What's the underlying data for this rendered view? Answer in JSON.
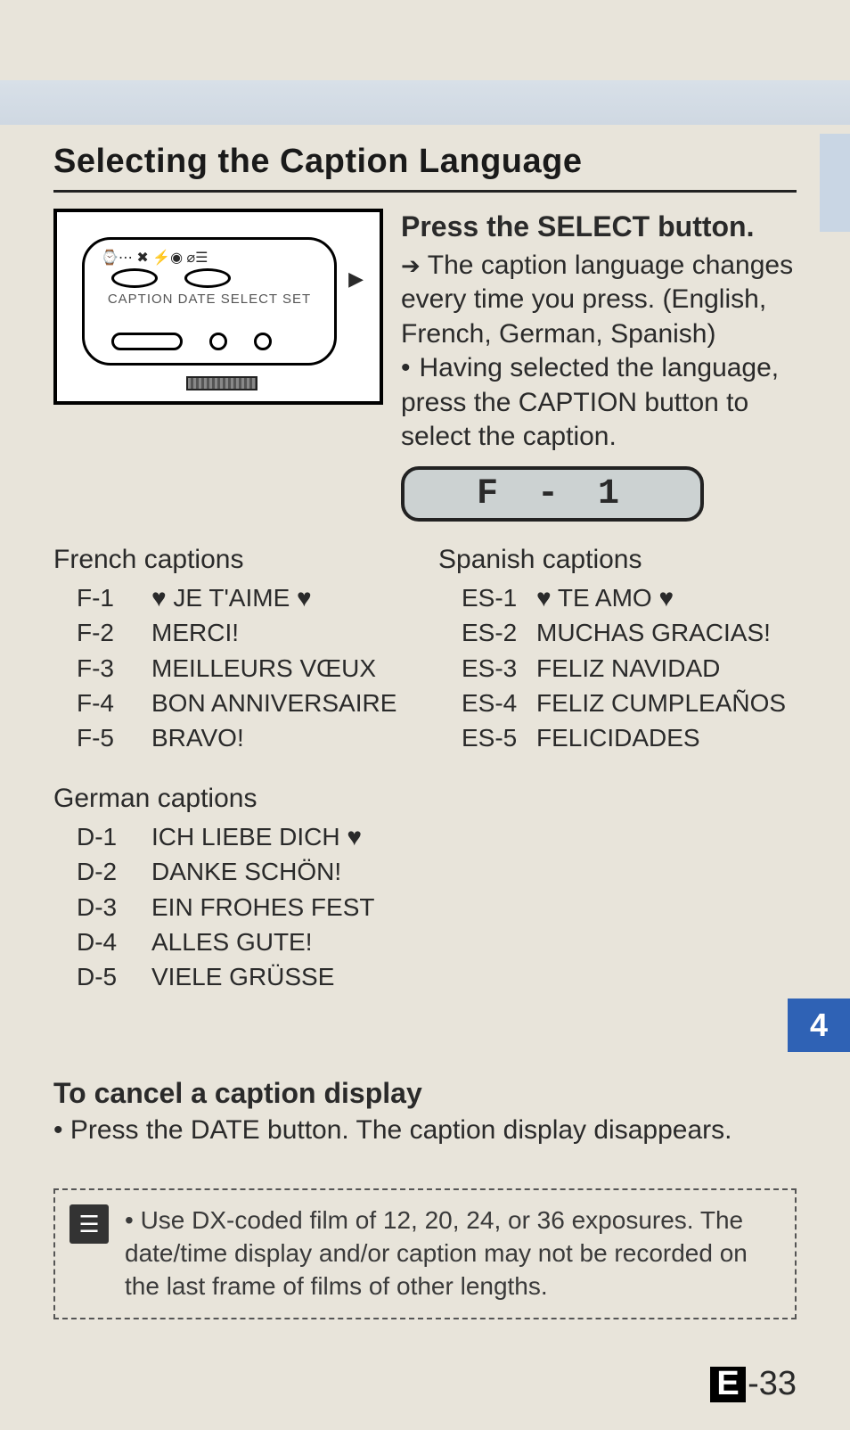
{
  "heading": "Selecting the Caption Language",
  "camera_labels": {
    "top_icons": "⌚⋯ ✖   ⚡◉    ⌀☰",
    "mid": "CAPTION  DATE   SELECT SET",
    "play": "▶"
  },
  "instructions": {
    "sub_h": "Press the SELECT button.",
    "arrow_line": "The caption language changes every time you press. (English, French, German, Spanish)",
    "dot_line": "Having selected the language, press the CAPTION button to select the caption."
  },
  "lcd": "F - 1",
  "french": {
    "title": "French captions",
    "items": [
      {
        "code": "F-1",
        "text": "♥ JE T'AIME ♥"
      },
      {
        "code": "F-2",
        "text": "MERCI!"
      },
      {
        "code": "F-3",
        "text": "MEILLEURS VŒUX"
      },
      {
        "code": "F-4",
        "text": "BON ANNIVERSAIRE"
      },
      {
        "code": "F-5",
        "text": "BRAVO!"
      }
    ]
  },
  "german": {
    "title": "German captions",
    "items": [
      {
        "code": "D-1",
        "text": "ICH LIEBE DICH ♥"
      },
      {
        "code": "D-2",
        "text": "DANKE SCHÖN!"
      },
      {
        "code": "D-3",
        "text": "EIN FROHES FEST"
      },
      {
        "code": "D-4",
        "text": "ALLES GUTE!"
      },
      {
        "code": "D-5",
        "text": "VIELE GRÜSSE"
      }
    ]
  },
  "spanish": {
    "title": "Spanish captions",
    "items": [
      {
        "code": "ES-1",
        "text": "♥ TE AMO ♥"
      },
      {
        "code": "ES-2",
        "text": "MUCHAS GRACIAS!"
      },
      {
        "code": "ES-3",
        "text": "FELIZ NAVIDAD"
      },
      {
        "code": "ES-4",
        "text": "FELIZ CUMPLEAÑOS"
      },
      {
        "code": "ES-5",
        "text": "FELICIDADES"
      }
    ]
  },
  "chapter_tab": "4",
  "cancel": {
    "title": "To cancel a caption display",
    "body": "• Press the DATE button. The caption display disappears."
  },
  "note": {
    "icon": "☰",
    "body": "• Use DX-coded film of 12, 20, 24, or 36 exposures. The date/time display and/or caption may not be recorded on the last frame of films of other lengths."
  },
  "page_number": {
    "prefix": "E",
    "num": "-33"
  }
}
